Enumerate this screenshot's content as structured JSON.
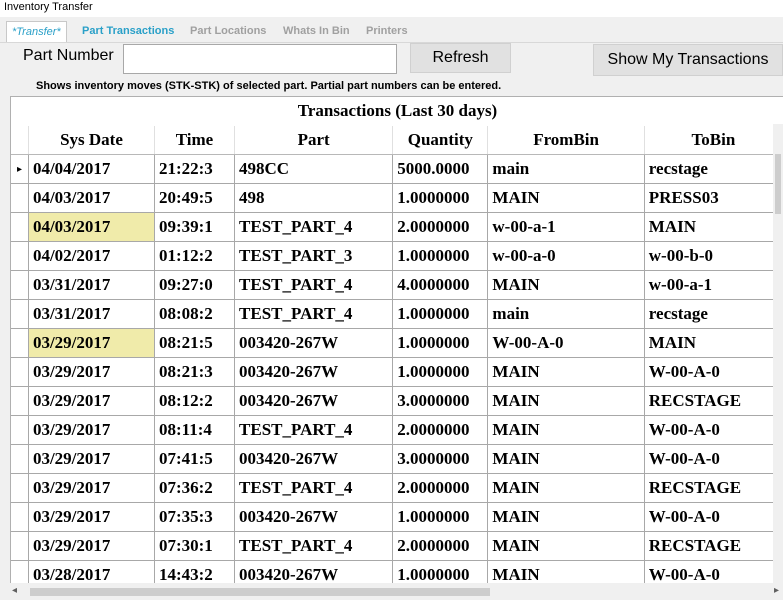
{
  "window": {
    "title": "Inventory Transfer"
  },
  "tabs": [
    {
      "label": "*Transfer*"
    },
    {
      "label": "Part Transactions"
    },
    {
      "label": "Part Locations"
    },
    {
      "label": "Whats In Bin"
    },
    {
      "label": "Printers"
    }
  ],
  "form": {
    "part_number_label": "Part Number",
    "part_number_value": "",
    "refresh_label": "Refresh",
    "my_transactions_label": "Show My Transactions",
    "hint": "Shows inventory moves (STK-STK) of selected part. Partial part numbers can be entered."
  },
  "grid": {
    "title": "Transactions (Last 30 days)",
    "columns": [
      "Sys Date",
      "Time",
      "Part",
      "Quantity",
      "FromBin",
      "ToBin"
    ],
    "row_pointer": "▸",
    "rows": [
      [
        "04/04/2017",
        "21:22:3",
        "498CC",
        "5000.0000",
        "main",
        "recstage"
      ],
      [
        "04/03/2017",
        "20:49:5",
        "498",
        "1.0000000",
        "MAIN",
        "PRESS03"
      ],
      [
        "04/03/2017",
        "09:39:1",
        "TEST_PART_4",
        "2.0000000",
        "w-00-a-1",
        "MAIN"
      ],
      [
        "04/02/2017",
        "01:12:2",
        "TEST_PART_3",
        "1.0000000",
        "w-00-a-0",
        "w-00-b-0"
      ],
      [
        "03/31/2017",
        "09:27:0",
        "TEST_PART_4",
        "4.0000000",
        "MAIN",
        "w-00-a-1"
      ],
      [
        "03/31/2017",
        "08:08:2",
        "TEST_PART_4",
        "1.0000000",
        "main",
        "recstage"
      ],
      [
        "03/29/2017",
        "08:21:5",
        "003420-267W",
        "1.0000000",
        "W-00-A-0",
        "MAIN"
      ],
      [
        "03/29/2017",
        "08:21:3",
        "003420-267W",
        "1.0000000",
        "MAIN",
        "W-00-A-0"
      ],
      [
        "03/29/2017",
        "08:12:2",
        "003420-267W",
        "3.0000000",
        "MAIN",
        "RECSTAGE"
      ],
      [
        "03/29/2017",
        "08:11:4",
        "TEST_PART_4",
        "2.0000000",
        "MAIN",
        "W-00-A-0"
      ],
      [
        "03/29/2017",
        "07:41:5",
        "003420-267W",
        "3.0000000",
        "MAIN",
        "W-00-A-0"
      ],
      [
        "03/29/2017",
        "07:36:2",
        "TEST_PART_4",
        "2.0000000",
        "MAIN",
        "RECSTAGE"
      ],
      [
        "03/29/2017",
        "07:35:3",
        "003420-267W",
        "1.0000000",
        "MAIN",
        "W-00-A-0"
      ],
      [
        "03/29/2017",
        "07:30:1",
        "TEST_PART_4",
        "2.0000000",
        "MAIN",
        "RECSTAGE"
      ],
      [
        "03/28/2017",
        "14:43:2",
        "003420-267W",
        "1.0000000",
        "MAIN",
        "W-00-A-0"
      ]
    ],
    "highlighted_rows": [
      2,
      6
    ]
  },
  "scroll": {
    "left_arrow": "◂",
    "right_arrow": "▸"
  }
}
